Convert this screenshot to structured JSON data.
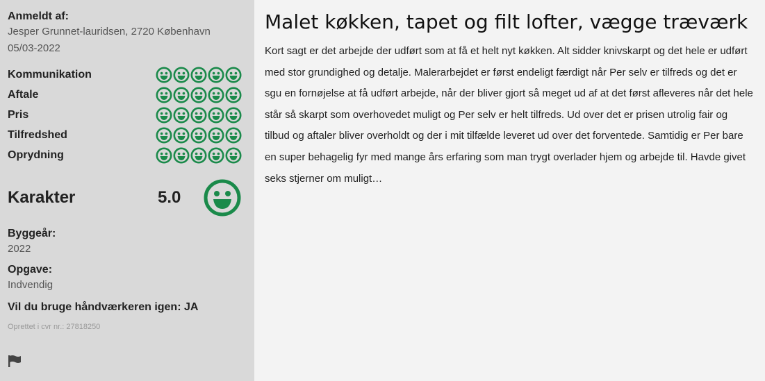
{
  "reviewer": {
    "label": "Anmeldt af:",
    "name_city": "Jesper Grunnet-lauridsen, 2720 København",
    "date": "05/03-2022"
  },
  "ratings": [
    {
      "label": "Kommunikation",
      "score": 5
    },
    {
      "label": "Aftale",
      "score": 5
    },
    {
      "label": "Pris",
      "score": 5
    },
    {
      "label": "Tilfredshed",
      "score": 5
    },
    {
      "label": "Oprydning",
      "score": 5
    }
  ],
  "grade": {
    "label": "Karakter",
    "value": "5.0"
  },
  "build_year": {
    "label": "Byggeår:",
    "value": "2022"
  },
  "task": {
    "label": "Opgave:",
    "value": "Indvendig"
  },
  "reuse": {
    "label": "Vil du bruge håndværkeren igen: JA"
  },
  "cvr": {
    "text": "Oprettet i cvr nr.: 27818250"
  },
  "review": {
    "title": "Malet køkken, tapet og filt lofter, vægge træværk",
    "body": "Kort sagt er det arbejde der udført som at få et helt nyt køkken. Alt sidder knivskarpt og det hele er udført med stor grundighed og detalje. Malerarbejdet er først endeligt færdigt når Per selv er tilfreds og det er sgu en fornøjelse at få udført arbejde, når der bliver gjort så meget ud af at det først afleveres når det hele står så skarpt som overhovedet muligt og Per selv er helt tilfreds. Ud over det er prisen utrolig fair og tilbud og aftaler bliver overholdt og der i mit tilfælde leveret ud over det forventede. Samtidig er Per bare en super behagelig fyr med mange års erfaring som man trygt overlader hjem og arbejde til. Havde givet seks stjerner om muligt…"
  },
  "icons": {
    "smiley": "smiley-icon",
    "flag": "flag-icon"
  },
  "colors": {
    "smiley_green": "#1a8a4a",
    "sidebar_bg": "#d9d9d9",
    "main_bg": "#f3f3f3"
  }
}
